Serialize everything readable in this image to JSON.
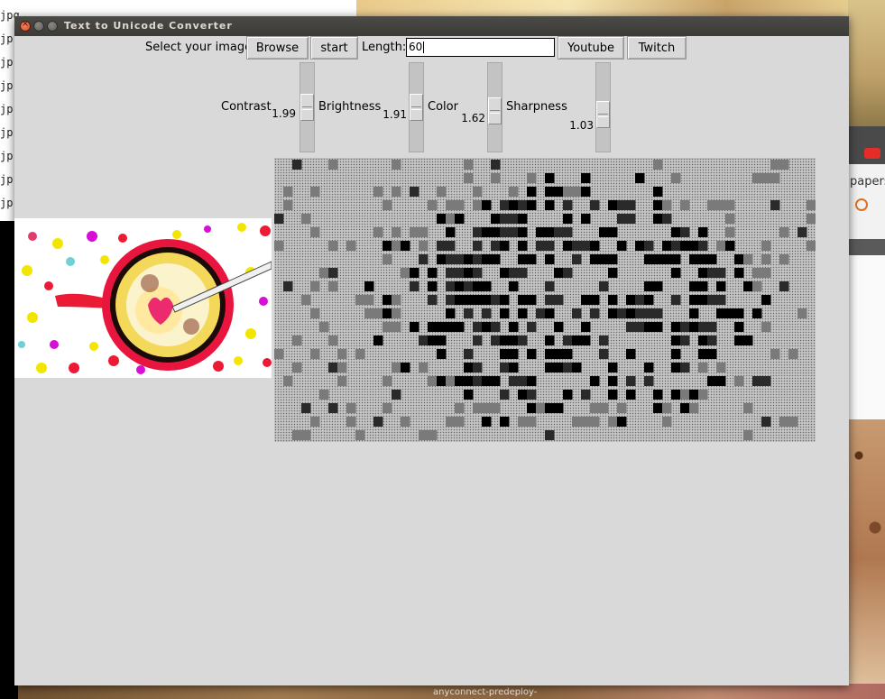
{
  "desktop": {
    "file_list": [
      "jpg",
      "jp",
      "jp",
      "jp",
      "jp",
      "jp",
      "jp",
      "jp",
      "jp"
    ],
    "browser_partial_text": "papers",
    "taskbar_label": "anyconnect-predeploy-"
  },
  "window": {
    "title": "Text to Unicode Converter",
    "close_glyph": "×"
  },
  "toolbar": {
    "select_label": "Select your image",
    "browse_label": "Browse",
    "start_label": "start",
    "length_label": "Length:",
    "length_value": "60",
    "youtube_label": "Youtube",
    "twitch_label": "Twitch"
  },
  "sliders": [
    {
      "label": "Contrast",
      "value": "1.99",
      "level": 0.5
    },
    {
      "label": "Brightness",
      "value": "1.91",
      "level": 0.5
    },
    {
      "label": "Color",
      "value": "1.62",
      "level": 0.55
    },
    {
      "label": "Sharpness",
      "value": "1.03",
      "level": 0.62
    }
  ],
  "ascii_output": {
    "rows": 21,
    "cols": 60,
    "palette": {
      "light": "#c4c4c4",
      "mid": "#7a7a7a",
      "dark": "#2a2a2a",
      "black": "#000000"
    }
  }
}
